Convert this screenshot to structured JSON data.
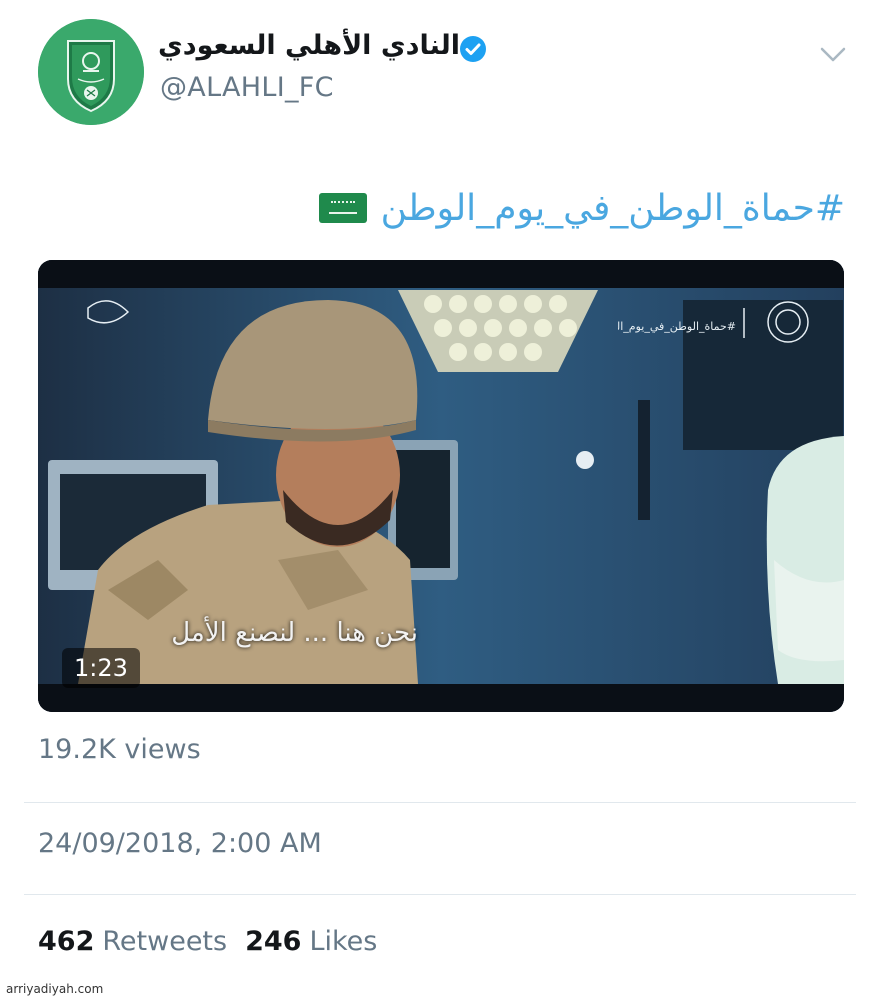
{
  "account": {
    "display_name": "النادي الأهلي السعودي",
    "handle": "@ALAHLI_FC",
    "verified": true,
    "avatar_icon": "al-ahli-club-crest-icon"
  },
  "tweet": {
    "hashtag": "#حماة_الوطن_في_يوم_الوطن",
    "emoji": "saudi-flag-icon"
  },
  "video": {
    "duration": "1:23",
    "subtitle": "نحن هنا ... لنصنع الأمل",
    "overlay_tag": "#حماة_الوطن_في_يوم_الوطن"
  },
  "meta": {
    "views": "19.2K views",
    "timestamp": "24/09/2018, 2:00 AM",
    "retweets_count": "462",
    "retweets_label": "Retweets",
    "likes_count": "246",
    "likes_label": "Likes"
  },
  "watermark": "arriyadiyah.com",
  "colors": {
    "link": "#4aa7e0",
    "secondary_text": "#657786",
    "avatar_bg": "#3aa96c",
    "verified": "#1da1f2"
  }
}
